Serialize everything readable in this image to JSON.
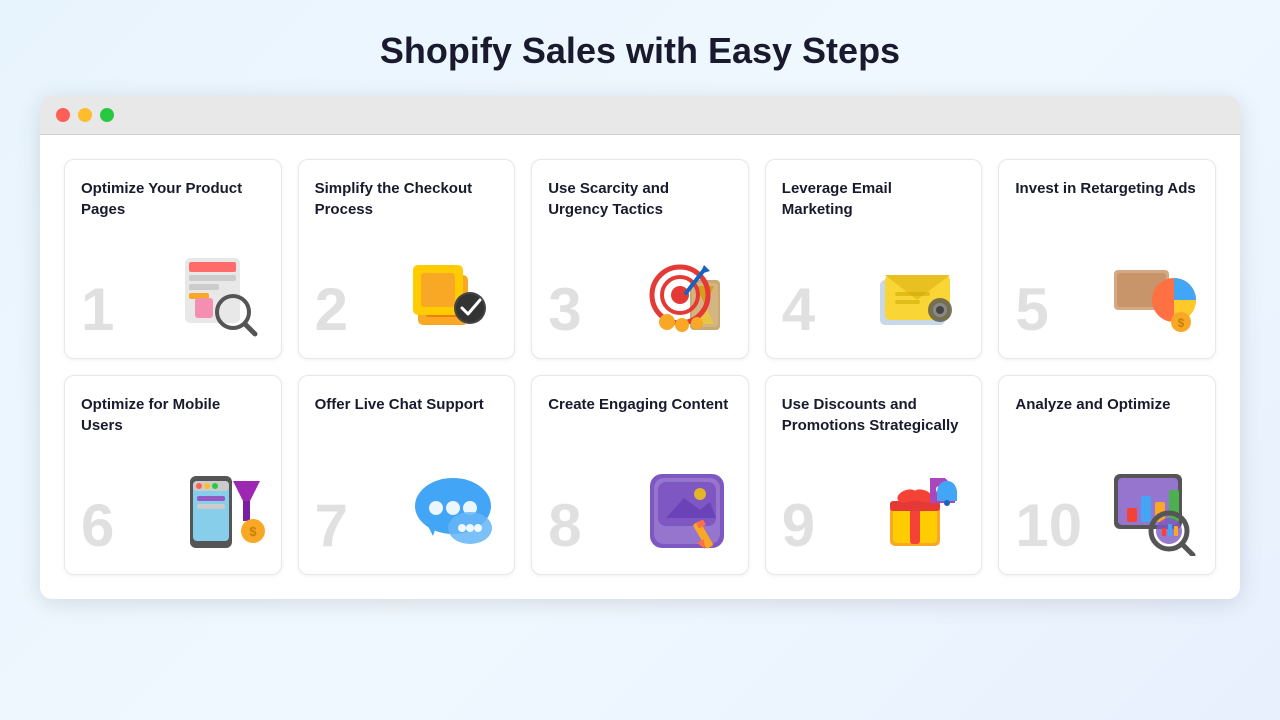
{
  "page": {
    "title": "Shopify Sales with Easy Steps"
  },
  "browser": {
    "traffic_lights": [
      "red",
      "yellow",
      "green"
    ]
  },
  "cards": [
    {
      "number": "1",
      "title": "Optimize Your Product Pages",
      "icon": "product-pages"
    },
    {
      "number": "2",
      "title": "Simplify the Checkout Process",
      "icon": "checkout"
    },
    {
      "number": "3",
      "title": "Use Scarcity and Urgency Tactics",
      "icon": "scarcity"
    },
    {
      "number": "4",
      "title": "Leverage Email Marketing",
      "icon": "email"
    },
    {
      "number": "5",
      "title": "Invest in Retargeting Ads",
      "icon": "retargeting"
    },
    {
      "number": "6",
      "title": "Optimize for Mobile Users",
      "icon": "mobile"
    },
    {
      "number": "7",
      "title": "Offer Live Chat Support",
      "icon": "chat"
    },
    {
      "number": "8",
      "title": "Create Engaging Content",
      "icon": "content"
    },
    {
      "number": "9",
      "title": "Use Discounts and Promotions Strategically",
      "icon": "discounts"
    },
    {
      "number": "10",
      "title": "Analyze and Optimize",
      "icon": "analyze"
    }
  ]
}
